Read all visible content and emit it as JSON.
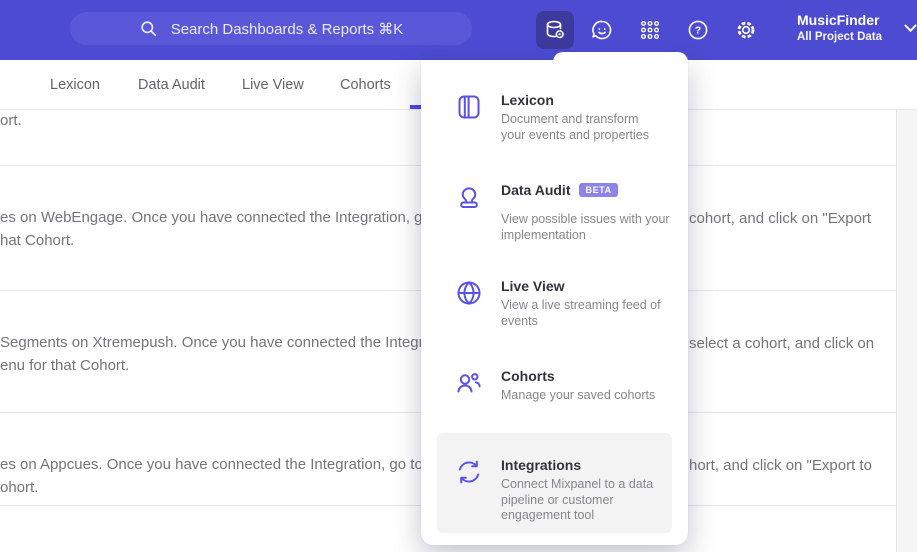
{
  "header": {
    "search_placeholder": "Search Dashboards & Reports ⌘K",
    "project_name": "MusicFinder",
    "project_scope": "All Project Data"
  },
  "navbar": {
    "tabs": [
      {
        "label": "Lexicon"
      },
      {
        "label": "Data Audit"
      },
      {
        "label": "Live View"
      },
      {
        "label": "Cohorts"
      }
    ]
  },
  "dropdown": {
    "items": [
      {
        "title": "Lexicon",
        "desc_lines": [
          "Document and transform",
          "your events and properties"
        ]
      },
      {
        "title": "Data Audit",
        "badge": "BETA",
        "desc_lines": [
          "View possible issues with your",
          "implementation"
        ]
      },
      {
        "title": "Live View",
        "desc_lines": [
          "View a live streaming feed of",
          "events"
        ]
      },
      {
        "title": "Cohorts",
        "desc_lines": [
          "Manage your saved cohorts"
        ]
      },
      {
        "title": "Integrations",
        "desc_lines": [
          "Connect Mixpanel to a data",
          "pipeline or customer",
          "engagement tool"
        ]
      }
    ]
  },
  "background_rows": [
    {
      "line1_left": "ort.",
      "line1_right": "",
      "line2": ""
    },
    {
      "line1_left": "es on WebEngage. Once you have connected the Integration, go to the",
      "line1_right": "cohort, and click on \"Export",
      "line2": "hat Cohort."
    },
    {
      "line1_left": "Segments on Xtremepush. Once you have connected the Integration,",
      "line1_right": "select a cohort, and click on",
      "line2": "enu for that Cohort."
    },
    {
      "line1_left": "es on Appcues. Once you have connected the Integration, go to the M",
      "line1_right": "hort, and click on \"Export to",
      "line2": "ohort."
    }
  ],
  "colors": {
    "header_bg": "#4c4bd2",
    "search_pill_bg": "#5a57d9",
    "active_tile_bg": "#3d3a9e",
    "accent": "#5246e0",
    "icon_purple": "#5a52e6",
    "badge_bg": "#8d84ea",
    "hover_item_bg": "#f3f3f4"
  }
}
